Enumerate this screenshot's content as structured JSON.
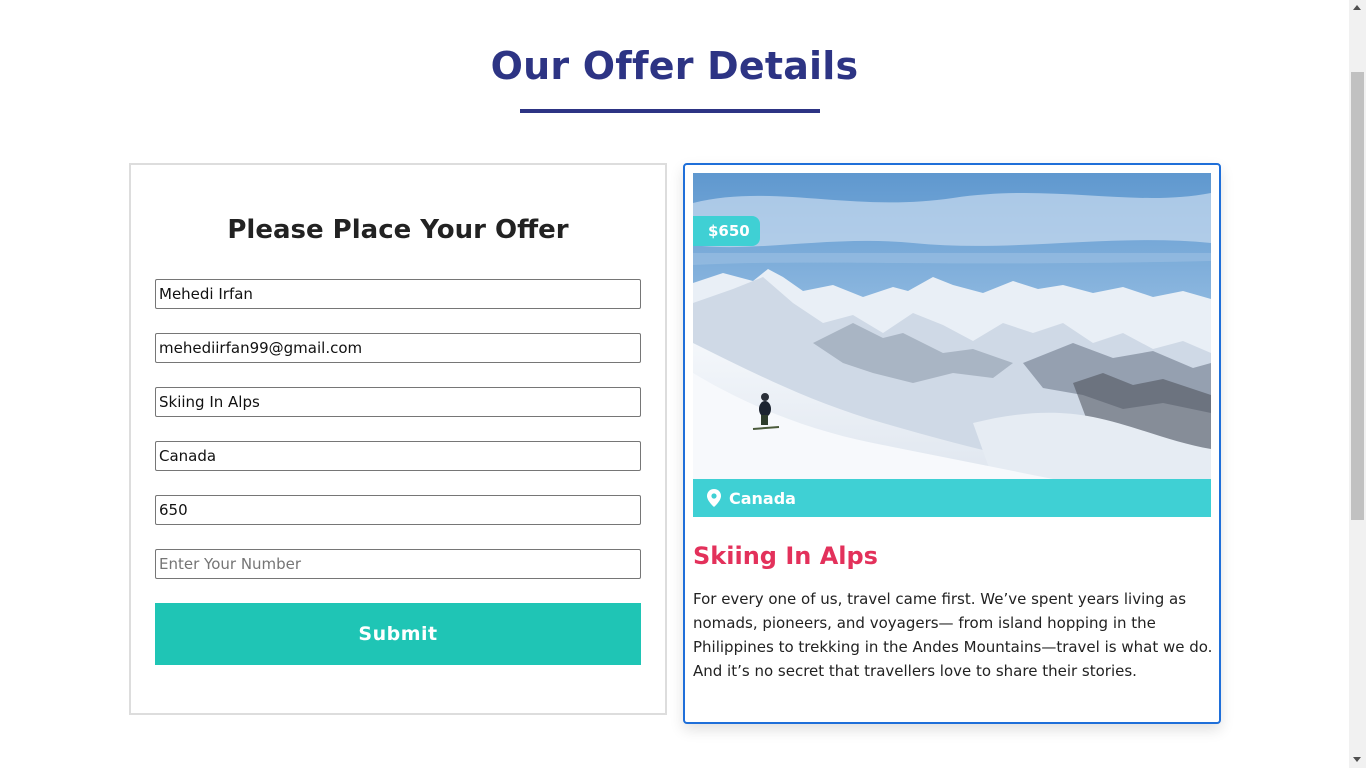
{
  "section": {
    "title": "Our Offer Details"
  },
  "form": {
    "heading": "Please Place Your Offer",
    "fields": [
      {
        "value": "Mehedi Irfan",
        "placeholder": ""
      },
      {
        "value": "mehediirfan99@gmail.com",
        "placeholder": ""
      },
      {
        "value": "Skiing In Alps",
        "placeholder": ""
      },
      {
        "value": "Canada",
        "placeholder": ""
      },
      {
        "value": "650",
        "placeholder": ""
      },
      {
        "value": "",
        "placeholder": "Enter Your Number"
      }
    ],
    "submit_label": "Submit"
  },
  "offer": {
    "price": "$650",
    "location": "Canada",
    "title": "Skiing In Alps",
    "description": "For every one of us, travel came first. We’ve spent years living as nomads, pioneers, and voyagers— from island hopping in the Philippines to trekking in the Andes Mountains—travel is what we do. And it’s no secret that travellers love to share their stories.",
    "icons": {
      "location": "map-pin-icon"
    }
  },
  "colors": {
    "title": "#2d3484",
    "submit": "#1fc5b5",
    "badge": "#3fd0d4",
    "offer_title": "#e3315b",
    "card_border": "#1f6fd9"
  }
}
